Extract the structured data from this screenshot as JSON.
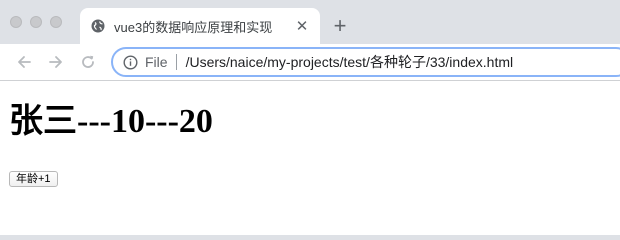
{
  "window": {
    "controls": [
      "close",
      "minimize",
      "maximize"
    ]
  },
  "tab": {
    "title": "vue3的数据响应原理和实现",
    "favicon": "globe-icon",
    "close_icon": "close-icon"
  },
  "new_tab": {
    "icon": "plus-icon",
    "label": "+"
  },
  "toolbar": {
    "back_icon": "back-arrow-icon",
    "forward_icon": "forward-arrow-icon",
    "reload_icon": "reload-icon"
  },
  "address": {
    "scheme_label": "File",
    "url": "/Users/naice/my-projects/test/各种轮子/33/index.html",
    "info_icon": "info-icon"
  },
  "page": {
    "heading": "张三---10---20",
    "button_label": "年龄+1"
  },
  "colors": {
    "tab_strip": "#dee1e6",
    "omnibox_focus": "#8ab4f8"
  }
}
